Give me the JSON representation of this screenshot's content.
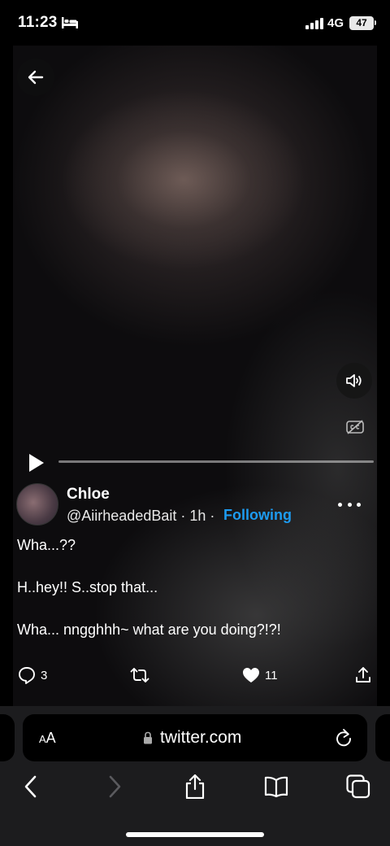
{
  "status_bar": {
    "time": "11:23",
    "network": "4G",
    "battery": "47"
  },
  "tweet": {
    "display_name": "Chloe",
    "handle": "@AiirheadedBait · 1h ·",
    "follow_status": "Following",
    "lines": [
      "Wha...??",
      "H..hey!! S..stop that...",
      "Wha... nngghhh~ what are you doing?!?!"
    ],
    "reply_count": "3",
    "like_count": "11"
  },
  "browser": {
    "text_size_label_big": "A",
    "text_size_label_small": "A",
    "url": "twitter.com"
  },
  "colors": {
    "accent": "#1d9bf0",
    "background": "#000000",
    "toolbar": "#1c1c1e"
  }
}
